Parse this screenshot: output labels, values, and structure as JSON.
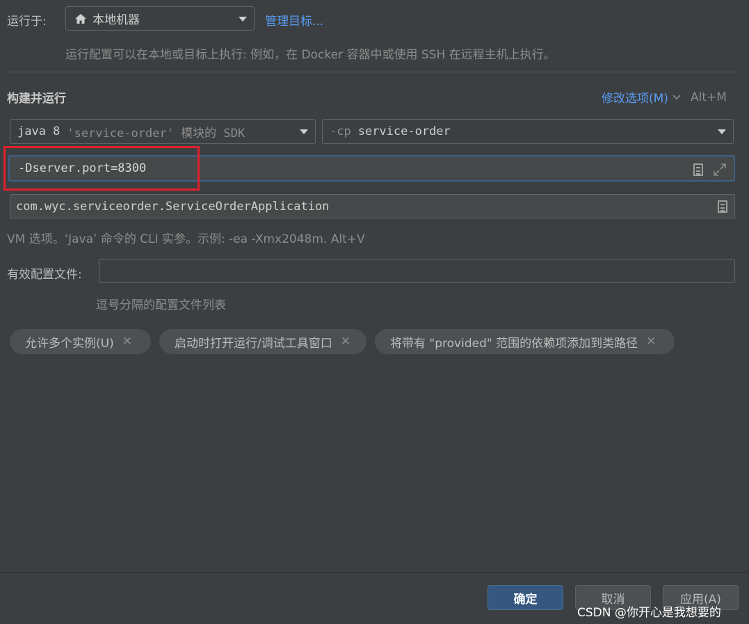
{
  "run_on": {
    "label": "运行于:",
    "target_value": "本地机器",
    "manage_link": "管理目标...",
    "hint": "运行配置可以在本地或目标上执行: 例如，在 Docker 容器中或使用 SSH 在远程主机上执行。"
  },
  "build_run": {
    "title": "构建并运行",
    "modify_options": "修改选项(M)",
    "modify_shortcut": "Alt+M",
    "jre_combo": {
      "java": "java 8",
      "module_hint": "'service-order' 模块的 SDK"
    },
    "classpath_combo": {
      "prefix": "-cp",
      "value": "service-order"
    },
    "vm_options_value": "-Dserver.port=8300",
    "main_class_value": "com.wyc.serviceorder.ServiceOrderApplication",
    "vm_hint": "VM 选项。‘Java’ 命令的 CLI 实参。示例: -ea -Xmx2048m. Alt+V"
  },
  "profiles": {
    "label": "有效配置文件:",
    "value": "",
    "hint": "逗号分隔的配置文件列表"
  },
  "chips": [
    {
      "label": "允许多个实例(U)"
    },
    {
      "label": "启动时打开运行/调试工具窗口"
    },
    {
      "label": "将带有 \"provided\" 范围的依赖项添加到类路径"
    }
  ],
  "buttons": {
    "ok": "确定",
    "cancel": "取消",
    "apply": "应用(A)"
  },
  "watermark": "CSDN @你开心是我想要的",
  "colors": {
    "background": "#3c3f41",
    "link": "#589df6",
    "focus_border": "#3d6185",
    "highlight_box": "#e0202c",
    "primary_button": "#365880"
  }
}
